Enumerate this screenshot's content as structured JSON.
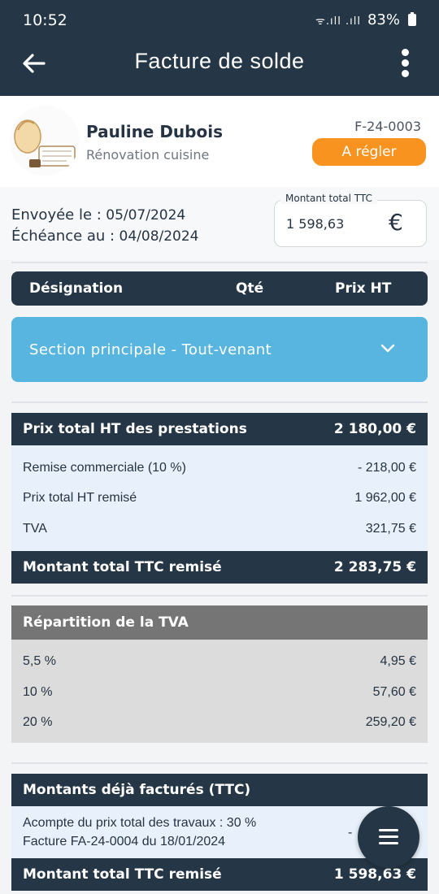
{
  "status_bar": {
    "time": "10:52",
    "signal": "ᯤ.ıll .ıll",
    "battery": "83%"
  },
  "header": {
    "title": "Facture de solde"
  },
  "client": {
    "name": "Pauline Dubois",
    "project": "Rénovation cuisine",
    "invoice_number": "F-24-0003",
    "status": "A régler"
  },
  "dates": {
    "sent_label": "Envoyée le :",
    "sent_value": "05/07/2024",
    "due_label": "Échéance au :",
    "due_value": "04/08/2024"
  },
  "total_ttc": {
    "label": "Montant total TTC",
    "value": "1 598,63",
    "currency": "€"
  },
  "table_header": {
    "designation": "Désignation",
    "qty": "Qté",
    "price": "Prix HT"
  },
  "section": {
    "label": "Section principale - Tout-venant"
  },
  "totals": {
    "ht_label": "Prix total HT des prestations",
    "ht_value": "2 180,00 €",
    "discount_label": "Remise commerciale (10 %)",
    "discount_value": "- 218,00 €",
    "ht_discounted_label": "Prix total HT remisé",
    "ht_discounted_value": "1 962,00 €",
    "tva_label": "TVA",
    "tva_value": "321,75 €",
    "ttc_label": "Montant total TTC remisé",
    "ttc_value": "2 283,75 €"
  },
  "tva_breakdown": {
    "title": "Répartition de la TVA",
    "rows": [
      {
        "rate": "5,5 %",
        "amount": "4,95 €"
      },
      {
        "rate": "10 %",
        "amount": "57,60 €"
      },
      {
        "rate": "20 %",
        "amount": "259,20 €"
      }
    ]
  },
  "already_invoiced": {
    "title": "Montants déjà facturés (TTC)",
    "line1": "Acompte du prix total des travaux :  30 %",
    "line2": "Facture FA-24-0004 du 18/01/2024",
    "partial_amount": "-",
    "footer_label": "Montant total TTC remisé",
    "footer_value": "1 598,63 €"
  }
}
